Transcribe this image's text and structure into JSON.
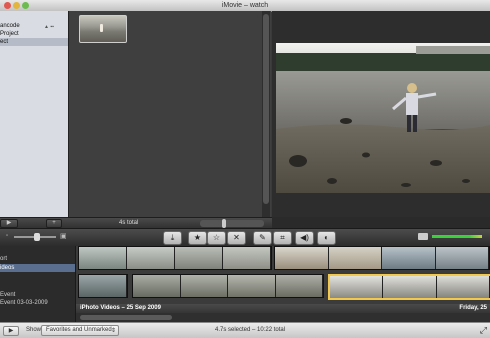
{
  "window": {
    "title": "iMovie – watch"
  },
  "project_library": {
    "items": [
      {
        "label": "ancode",
        "selected": false
      },
      {
        "label": "Project",
        "selected": false
      },
      {
        "label": "ect",
        "selected": true
      }
    ],
    "total": "4s total"
  },
  "event_library": {
    "items": [
      {
        "label": "ort",
        "selected": false
      },
      {
        "label": "ideos",
        "selected": true
      },
      {
        "label": "Event",
        "selected": false
      },
      {
        "label": "Event 03-03-2009",
        "selected": false
      }
    ],
    "header": {
      "left": "iPhoto Videos – 25 Sep 2009",
      "right": "Friday, 25"
    }
  },
  "status": {
    "show_label": "Show:",
    "show_value": "Favorites and Unmarked",
    "selection": "4.7s selected – 10:22 total"
  },
  "toolbar": {
    "tools": [
      {
        "icon": "import-icon",
        "glyph": "⤓"
      },
      {
        "icon": "favorite-star-icon",
        "glyph": "★"
      },
      {
        "icon": "unmark-star-icon",
        "glyph": "☆"
      },
      {
        "icon": "reject-x-icon",
        "glyph": "✕"
      },
      {
        "icon": "keyword-pen-icon",
        "glyph": "✎"
      },
      {
        "icon": "crop-icon",
        "glyph": "⌗"
      },
      {
        "icon": "audio-icon",
        "glyph": "◀)"
      },
      {
        "icon": "adjust-icon",
        "glyph": "◐"
      }
    ]
  }
}
